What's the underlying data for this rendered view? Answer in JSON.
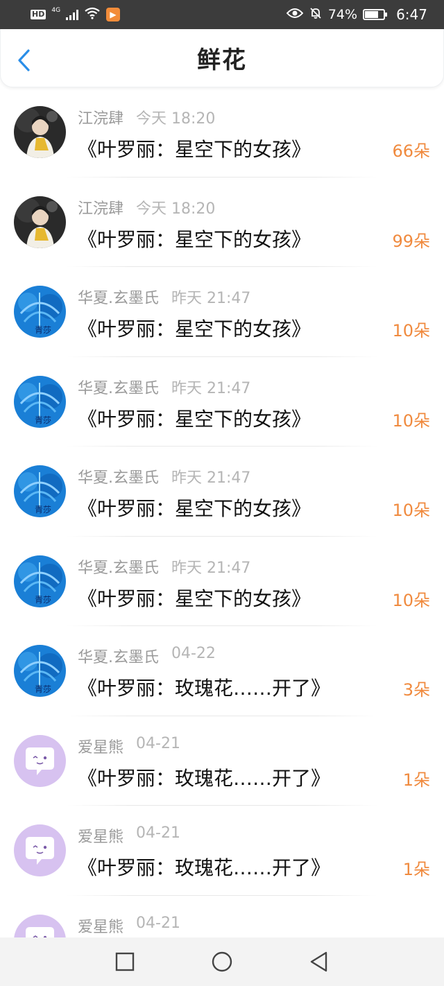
{
  "status_bar": {
    "hd": "HD",
    "network": "4G",
    "battery": "74%",
    "battery_level": 0.74,
    "time": "6:47",
    "icons": [
      "signal-icon",
      "wifi-icon",
      "app-notification-icon",
      "eye-icon",
      "mute-bell-icon",
      "battery-icon"
    ]
  },
  "header": {
    "title": "鲜花",
    "back_icon": "chevron-left-icon",
    "accent_color": "#2a8ee8"
  },
  "items": [
    {
      "user": "江浣肆",
      "time": "今天 18:20",
      "book": "《叶罗丽：星空下的女孩》",
      "count": "66朵",
      "avatar": "photo"
    },
    {
      "user": "江浣肆",
      "time": "今天 18:20",
      "book": "《叶罗丽：星空下的女孩》",
      "count": "99朵",
      "avatar": "photo"
    },
    {
      "user": "华夏.玄墨氏",
      "time": "昨天 21:47",
      "book": "《叶罗丽：星空下的女孩》",
      "count": "10朵",
      "avatar": "blue"
    },
    {
      "user": "华夏.玄墨氏",
      "time": "昨天 21:47",
      "book": "《叶罗丽：星空下的女孩》",
      "count": "10朵",
      "avatar": "blue"
    },
    {
      "user": "华夏.玄墨氏",
      "time": "昨天 21:47",
      "book": "《叶罗丽：星空下的女孩》",
      "count": "10朵",
      "avatar": "blue"
    },
    {
      "user": "华夏.玄墨氏",
      "time": "昨天 21:47",
      "book": "《叶罗丽：星空下的女孩》",
      "count": "10朵",
      "avatar": "blue"
    },
    {
      "user": "华夏.玄墨氏",
      "time": "04-22",
      "book": "《叶罗丽：玫瑰花……开了》",
      "count": "3朵",
      "avatar": "blue"
    },
    {
      "user": "爱星熊",
      "time": "04-21",
      "book": "《叶罗丽：玫瑰花……开了》",
      "count": "1朵",
      "avatar": "purple"
    },
    {
      "user": "爱星熊",
      "time": "04-21",
      "book": "《叶罗丽：玫瑰花……开了》",
      "count": "1朵",
      "avatar": "purple"
    },
    {
      "user": "爱星熊",
      "time": "04-21",
      "book": "",
      "count": "",
      "avatar": "purple"
    }
  ],
  "colors": {
    "count": "#f08a3e",
    "username": "#9a9a9a",
    "status_bar": "#3c3c3c",
    "avatar_purple": "#d7c2f0",
    "avatar_blue": "#1a7fd6"
  },
  "avatar_text": {
    "blue": "青莎"
  },
  "navbar": {
    "icons": [
      "recent-apps-icon",
      "home-icon",
      "back-triangle-icon"
    ]
  }
}
